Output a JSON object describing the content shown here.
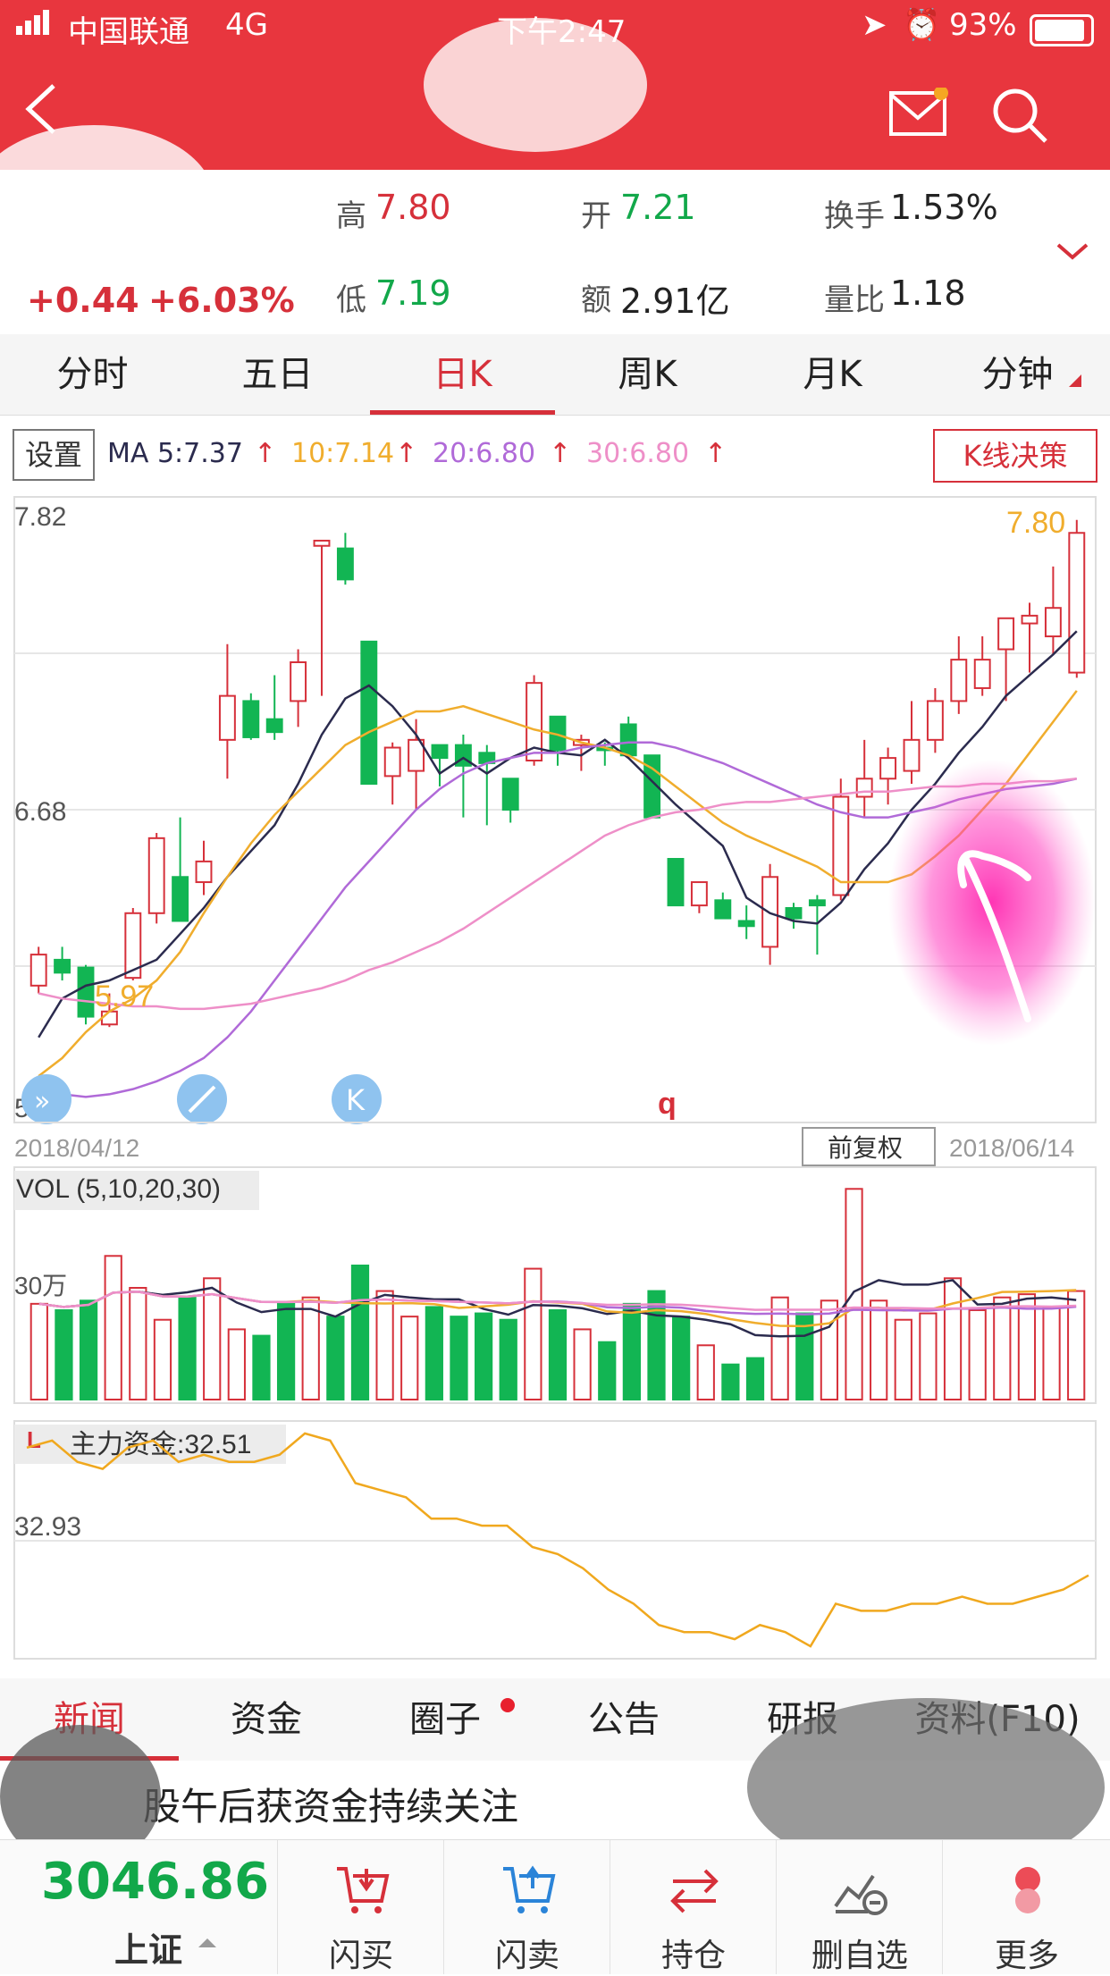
{
  "status_bar": {
    "carrier": "中国联通",
    "network": "4G",
    "time": "下午2:47",
    "battery": "93%"
  },
  "quote": {
    "change": "+0.44",
    "change_pct": "+6.03%",
    "high_label": "高",
    "high": "7.80",
    "low_label": "低",
    "low": "7.19",
    "open_label": "开",
    "open": "7.21",
    "amount_label": "额",
    "amount": "2.91亿",
    "turnover_label": "换手",
    "turnover": "1.53%",
    "volume_ratio_label": "量比",
    "volume_ratio": "1.18"
  },
  "period_tabs": [
    "分时",
    "五日",
    "日K",
    "周K",
    "月K",
    "分钟"
  ],
  "active_period_tab": "日K",
  "ma_bar": {
    "settings_label": "设置",
    "ma5": "MA 5:7.37",
    "ma10": "10:7.14",
    "ma20": "20:6.80",
    "ma30": "30:6.80",
    "decision_label": "K线决策",
    "colors": {
      "ma5": "#2b2b4e",
      "ma10": "#f0ad2d",
      "ma20": "#b06ad8",
      "ma30": "#ee8fc8",
      "up": "#d6303a",
      "down": "#12b553"
    }
  },
  "chart_data": [
    {
      "type": "candlestick",
      "ylim": [
        5.54,
        7.82
      ],
      "y_tick_labels": [
        "7.82",
        "6.68",
        "5.54"
      ],
      "annotations": {
        "max": "7.80",
        "min": "5.97",
        "glyph": "q"
      },
      "date_start": "2018/04/12",
      "date_end": "2018/06/14",
      "adjust_button": "前复权",
      "candles": [
        {
          "o": 6.0,
          "h": 6.15,
          "l": 5.97,
          "c": 6.12
        },
        {
          "o": 6.1,
          "h": 6.15,
          "l": 6.02,
          "c": 6.05
        },
        {
          "o": 6.07,
          "h": 6.08,
          "l": 5.85,
          "c": 5.88
        },
        {
          "o": 5.85,
          "h": 5.97,
          "l": 5.84,
          "c": 5.9
        },
        {
          "o": 6.03,
          "h": 6.3,
          "l": 6.02,
          "c": 6.28
        },
        {
          "o": 6.28,
          "h": 6.59,
          "l": 6.24,
          "c": 6.57
        },
        {
          "o": 6.42,
          "h": 6.65,
          "l": 6.25,
          "c": 6.25
        },
        {
          "o": 6.4,
          "h": 6.56,
          "l": 6.35,
          "c": 6.48
        },
        {
          "o": 6.95,
          "h": 7.32,
          "l": 6.8,
          "c": 7.12
        },
        {
          "o": 7.1,
          "h": 7.13,
          "l": 6.95,
          "c": 6.96
        },
        {
          "o": 7.03,
          "h": 7.2,
          "l": 6.95,
          "c": 6.98
        },
        {
          "o": 7.1,
          "h": 7.3,
          "l": 7.0,
          "c": 7.25
        },
        {
          "o": 7.7,
          "h": 7.72,
          "l": 7.12,
          "c": 7.72
        },
        {
          "o": 7.69,
          "h": 7.75,
          "l": 7.55,
          "c": 7.57
        },
        {
          "o": 7.33,
          "h": 7.33,
          "l": 6.78,
          "c": 6.78
        },
        {
          "o": 6.81,
          "h": 6.94,
          "l": 6.7,
          "c": 6.92
        },
        {
          "o": 6.83,
          "h": 7.03,
          "l": 6.68,
          "c": 6.95
        },
        {
          "o": 6.93,
          "h": 6.93,
          "l": 6.77,
          "c": 6.88
        },
        {
          "o": 6.93,
          "h": 6.97,
          "l": 6.65,
          "c": 6.85
        },
        {
          "o": 6.9,
          "h": 6.93,
          "l": 6.62,
          "c": 6.86
        },
        {
          "o": 6.8,
          "h": 6.8,
          "l": 6.63,
          "c": 6.68
        },
        {
          "o": 6.87,
          "h": 7.2,
          "l": 6.85,
          "c": 7.17
        },
        {
          "o": 7.04,
          "h": 7.04,
          "l": 6.85,
          "c": 6.91
        },
        {
          "o": 6.93,
          "h": 6.97,
          "l": 6.83,
          "c": 6.95
        },
        {
          "o": 6.92,
          "h": 6.94,
          "l": 6.85,
          "c": 6.91
        },
        {
          "o": 7.01,
          "h": 7.04,
          "l": 6.89,
          "c": 6.89
        },
        {
          "o": 6.89,
          "h": 6.89,
          "l": 6.65,
          "c": 6.65
        },
        {
          "o": 6.49,
          "h": 6.49,
          "l": 6.31,
          "c": 6.31
        },
        {
          "o": 6.31,
          "h": 6.39,
          "l": 6.28,
          "c": 6.4
        },
        {
          "o": 6.33,
          "h": 6.36,
          "l": 6.26,
          "c": 6.26
        },
        {
          "o": 6.25,
          "h": 6.31,
          "l": 6.18,
          "c": 6.23
        },
        {
          "o": 6.15,
          "h": 6.47,
          "l": 6.08,
          "c": 6.42
        },
        {
          "o": 6.3,
          "h": 6.32,
          "l": 6.22,
          "c": 6.26
        },
        {
          "o": 6.33,
          "h": 6.35,
          "l": 6.12,
          "c": 6.31
        },
        {
          "o": 6.35,
          "h": 6.8,
          "l": 6.33,
          "c": 6.73
        },
        {
          "o": 6.73,
          "h": 6.95,
          "l": 6.65,
          "c": 6.8
        },
        {
          "o": 6.8,
          "h": 6.92,
          "l": 6.7,
          "c": 6.88
        },
        {
          "o": 6.83,
          "h": 7.1,
          "l": 6.78,
          "c": 6.95
        },
        {
          "o": 6.95,
          "h": 7.15,
          "l": 6.9,
          "c": 7.1
        },
        {
          "o": 7.1,
          "h": 7.35,
          "l": 7.05,
          "c": 7.26
        },
        {
          "o": 7.15,
          "h": 7.35,
          "l": 7.12,
          "c": 7.26
        },
        {
          "o": 7.3,
          "h": 7.42,
          "l": 7.1,
          "c": 7.42
        },
        {
          "o": 7.4,
          "h": 7.48,
          "l": 7.21,
          "c": 7.43
        },
        {
          "o": 7.35,
          "h": 7.62,
          "l": 7.28,
          "c": 7.46
        },
        {
          "o": 7.21,
          "h": 7.8,
          "l": 7.19,
          "c": 7.75
        }
      ],
      "ma_series": [
        {
          "name": "MA5",
          "values": [
            5.8,
            5.95,
            6.0,
            6.02,
            6.06,
            6.1,
            6.2,
            6.3,
            6.42,
            6.52,
            6.62,
            6.78,
            6.97,
            7.11,
            7.16,
            7.08,
            6.97,
            6.82,
            6.88,
            6.82,
            6.88,
            6.92,
            6.9,
            6.89,
            6.95,
            6.88,
            6.79,
            6.7,
            6.62,
            6.54,
            6.34,
            6.28,
            6.25,
            6.24,
            6.32,
            6.45,
            6.55,
            6.68,
            6.78,
            6.9,
            7.0,
            7.12,
            7.2,
            7.28,
            7.37
          ]
        },
        {
          "name": "MA10",
          "values": [
            5.65,
            5.72,
            5.82,
            5.9,
            5.95,
            6.02,
            6.13,
            6.28,
            6.42,
            6.55,
            6.66,
            6.75,
            6.84,
            6.93,
            6.98,
            7.02,
            7.06,
            7.06,
            7.08,
            7.05,
            7.02,
            6.99,
            6.97,
            6.94,
            6.92,
            6.89,
            6.84,
            6.77,
            6.7,
            6.63,
            6.58,
            6.54,
            6.5,
            6.46,
            6.4,
            6.4,
            6.4,
            6.43,
            6.5,
            6.58,
            6.68,
            6.78,
            6.9,
            7.02,
            7.14
          ]
        },
        {
          "name": "MA20",
          "values": [
            5.6,
            5.58,
            5.57,
            5.58,
            5.6,
            5.63,
            5.67,
            5.72,
            5.8,
            5.9,
            6.02,
            6.14,
            6.26,
            6.38,
            6.48,
            6.58,
            6.68,
            6.76,
            6.82,
            6.86,
            6.88,
            6.9,
            6.9,
            6.92,
            6.93,
            6.94,
            6.94,
            6.92,
            6.89,
            6.86,
            6.82,
            6.78,
            6.74,
            6.7,
            6.67,
            6.65,
            6.65,
            6.67,
            6.69,
            6.72,
            6.74,
            6.76,
            6.77,
            6.78,
            6.8
          ]
        },
        {
          "name": "MA30",
          "values": [
            5.97,
            5.95,
            5.94,
            5.93,
            5.92,
            5.92,
            5.91,
            5.91,
            5.92,
            5.93,
            5.95,
            5.97,
            5.99,
            6.02,
            6.06,
            6.09,
            6.13,
            6.17,
            6.22,
            6.28,
            6.34,
            6.4,
            6.46,
            6.52,
            6.58,
            6.62,
            6.65,
            6.67,
            6.68,
            6.7,
            6.71,
            6.71,
            6.72,
            6.73,
            6.74,
            6.75,
            6.75,
            6.76,
            6.77,
            6.77,
            6.78,
            6.78,
            6.79,
            6.79,
            6.8
          ]
        }
      ]
    },
    {
      "type": "bar",
      "title": "VOL (5,10,20,30)",
      "y_tick_labels": [
        "30万"
      ],
      "values": [
        30,
        28,
        31,
        45,
        35,
        25,
        32,
        38,
        22,
        20,
        30,
        32,
        26,
        42,
        34,
        26,
        29,
        26,
        27,
        25,
        41,
        28,
        22,
        18,
        30,
        34,
        26,
        17,
        11,
        13,
        32,
        27,
        31,
        66,
        31,
        25,
        27,
        38,
        28,
        32,
        33,
        29,
        34
      ]
    },
    {
      "type": "line",
      "title": "主力资金:32.51",
      "y_tick_labels": [
        "32.93"
      ],
      "values": [
        32.98,
        32.99,
        32.96,
        32.95,
        32.98,
        32.99,
        32.96,
        32.97,
        32.96,
        32.96,
        32.97,
        33.0,
        32.99,
        32.93,
        32.92,
        32.91,
        32.88,
        32.88,
        32.87,
        32.87,
        32.84,
        32.83,
        32.81,
        32.78,
        32.76,
        32.73,
        32.72,
        32.72,
        32.71,
        32.73,
        32.72,
        32.7,
        32.76,
        32.75,
        32.75,
        32.76,
        32.76,
        32.77,
        32.76,
        32.76,
        32.77,
        32.78,
        32.8
      ]
    }
  ],
  "news_tabs": [
    "新闻",
    "资金",
    "圈子",
    "公告",
    "研报",
    "资料(F10)"
  ],
  "news_headline": "股午后获资金持续关注",
  "index": {
    "value": "3046.86",
    "name": "上证"
  },
  "bottom_actions": [
    "闪买",
    "闪卖",
    "持仓",
    "删自选",
    "更多"
  ]
}
